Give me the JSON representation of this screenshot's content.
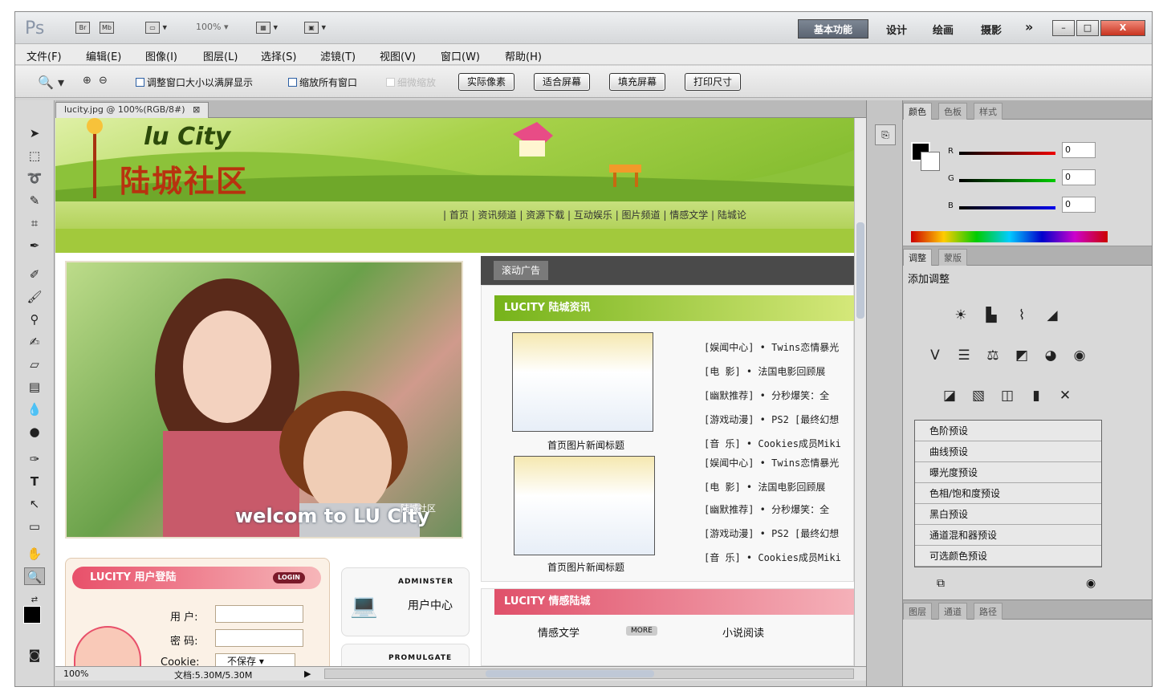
{
  "topbar": {
    "logo": "Ps",
    "zoom_value": "100%",
    "workspaces": [
      "基本功能",
      "设计",
      "绘画",
      "摄影"
    ],
    "more_label": "»",
    "window_controls": [
      "–",
      "□",
      "X"
    ]
  },
  "menu": [
    "文件(F)",
    "编辑(E)",
    "图像(I)",
    "图层(L)",
    "选择(S)",
    "滤镜(T)",
    "视图(V)",
    "窗口(W)",
    "帮助(H)"
  ],
  "options": {
    "cb_resize": "调整窗口大小以满屏显示",
    "cb_zoom_all": "缩放所有窗口",
    "cb_scrubby": "细微缩放",
    "btn_actual": "实际像素",
    "btn_fit": "适合屏幕",
    "btn_fill": "填充屏幕",
    "btn_print": "打印尺寸"
  },
  "document": {
    "tab_label": "lucity.jpg @ 100%(RGB/8#)",
    "zoom": "100%",
    "doc_size": "文档:5.30M/5.30M"
  },
  "page": {
    "logo_text": "lu City",
    "logo_cn": "陆城社区",
    "nav": "| 首页 | 资讯频道 | 资源下载 | 互动娱乐 | 图片频道 | 情感文学 | 陆城论",
    "hero_overlay": "welcom to LU City",
    "hero_sig": "陆城社区",
    "login_title": "LUCITY 用户登陆",
    "login_badge": "LOGIN",
    "user_label": "用 户:",
    "pass_label": "密 码:",
    "cookie_label": "Cookie:",
    "cookie_select": "不保存",
    "admin_label": "ADMINSTER",
    "admin_cn": "用户中心",
    "promo_label": "PROMULGATE",
    "ad_label": "滚动广告",
    "news_title": "LUCITY 陆城资讯",
    "thumb_caption": "首页图片新闻标题",
    "news": [
      "[娱闻中心] • Twins恋情暴光",
      "[电  影] • 法国电影回顾展",
      "[幽默推荐] • 分秒爆笑：全",
      "[游戏动漫] • PS2 [最终幻想",
      "[音  乐] • Cookies成员Miki",
      "[娱闻中心] • Twins恋情暴光",
      "[电  影] • 法国电影回顾展",
      "[幽默推荐] • 分秒爆笑：全",
      "[游戏动漫] • PS2 [最终幻想",
      "[音  乐] • Cookies成员Miki"
    ],
    "emo_title": "LUCITY 情感陆城",
    "emo_item1": "情感文学",
    "emo_more": "MORE",
    "emo_item2": "小说阅读"
  },
  "color_panel": {
    "tabs": [
      "颜色",
      "色板",
      "样式"
    ],
    "labels": [
      "R",
      "G",
      "B"
    ],
    "values": [
      "0",
      "0",
      "0"
    ]
  },
  "adjust_panel": {
    "tabs": [
      "调整",
      "蒙版"
    ],
    "title": "添加调整",
    "presets": [
      "色阶预设",
      "曲线预设",
      "曝光度预设",
      "色相/饱和度预设",
      "黑白预设",
      "通道混和器预设",
      "可选颜色预设"
    ]
  },
  "layers_panel": {
    "tabs": [
      "图层",
      "通道",
      "路径"
    ]
  },
  "colors": {
    "accent_green": "#7cb82a",
    "accent_pink": "#e0506a",
    "logo_red": "#b8320f"
  }
}
